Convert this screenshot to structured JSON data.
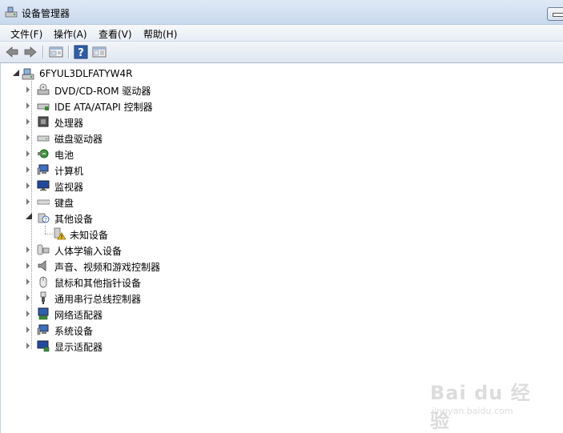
{
  "window": {
    "title": "设备管理器"
  },
  "menu": [
    "文件(F)",
    "操作(A)",
    "查看(V)",
    "帮助(H)"
  ],
  "toolbar": [
    "back-icon",
    "forward-icon",
    "properties-icon",
    "help-icon",
    "show-hide-console-tree-icon"
  ],
  "tree": {
    "root": "6FYUL3DLFATYW4R",
    "categories": [
      "DVD/CD-ROM 驱动器",
      "IDE ATA/ATAPI 控制器",
      "处理器",
      "磁盘驱动器",
      "电池",
      "计算机",
      "监视器",
      "键盘",
      "其他设备",
      "人体学输入设备",
      "声音、视频和游戏控制器",
      "鼠标和其他指针设备",
      "通用串行总线控制器",
      "网络适配器",
      "系统设备",
      "显示适配器"
    ],
    "other_devices_child": "未知设备"
  },
  "watermark": {
    "main": "Bai du 经验",
    "sub": "jingyan.baidu.com"
  }
}
